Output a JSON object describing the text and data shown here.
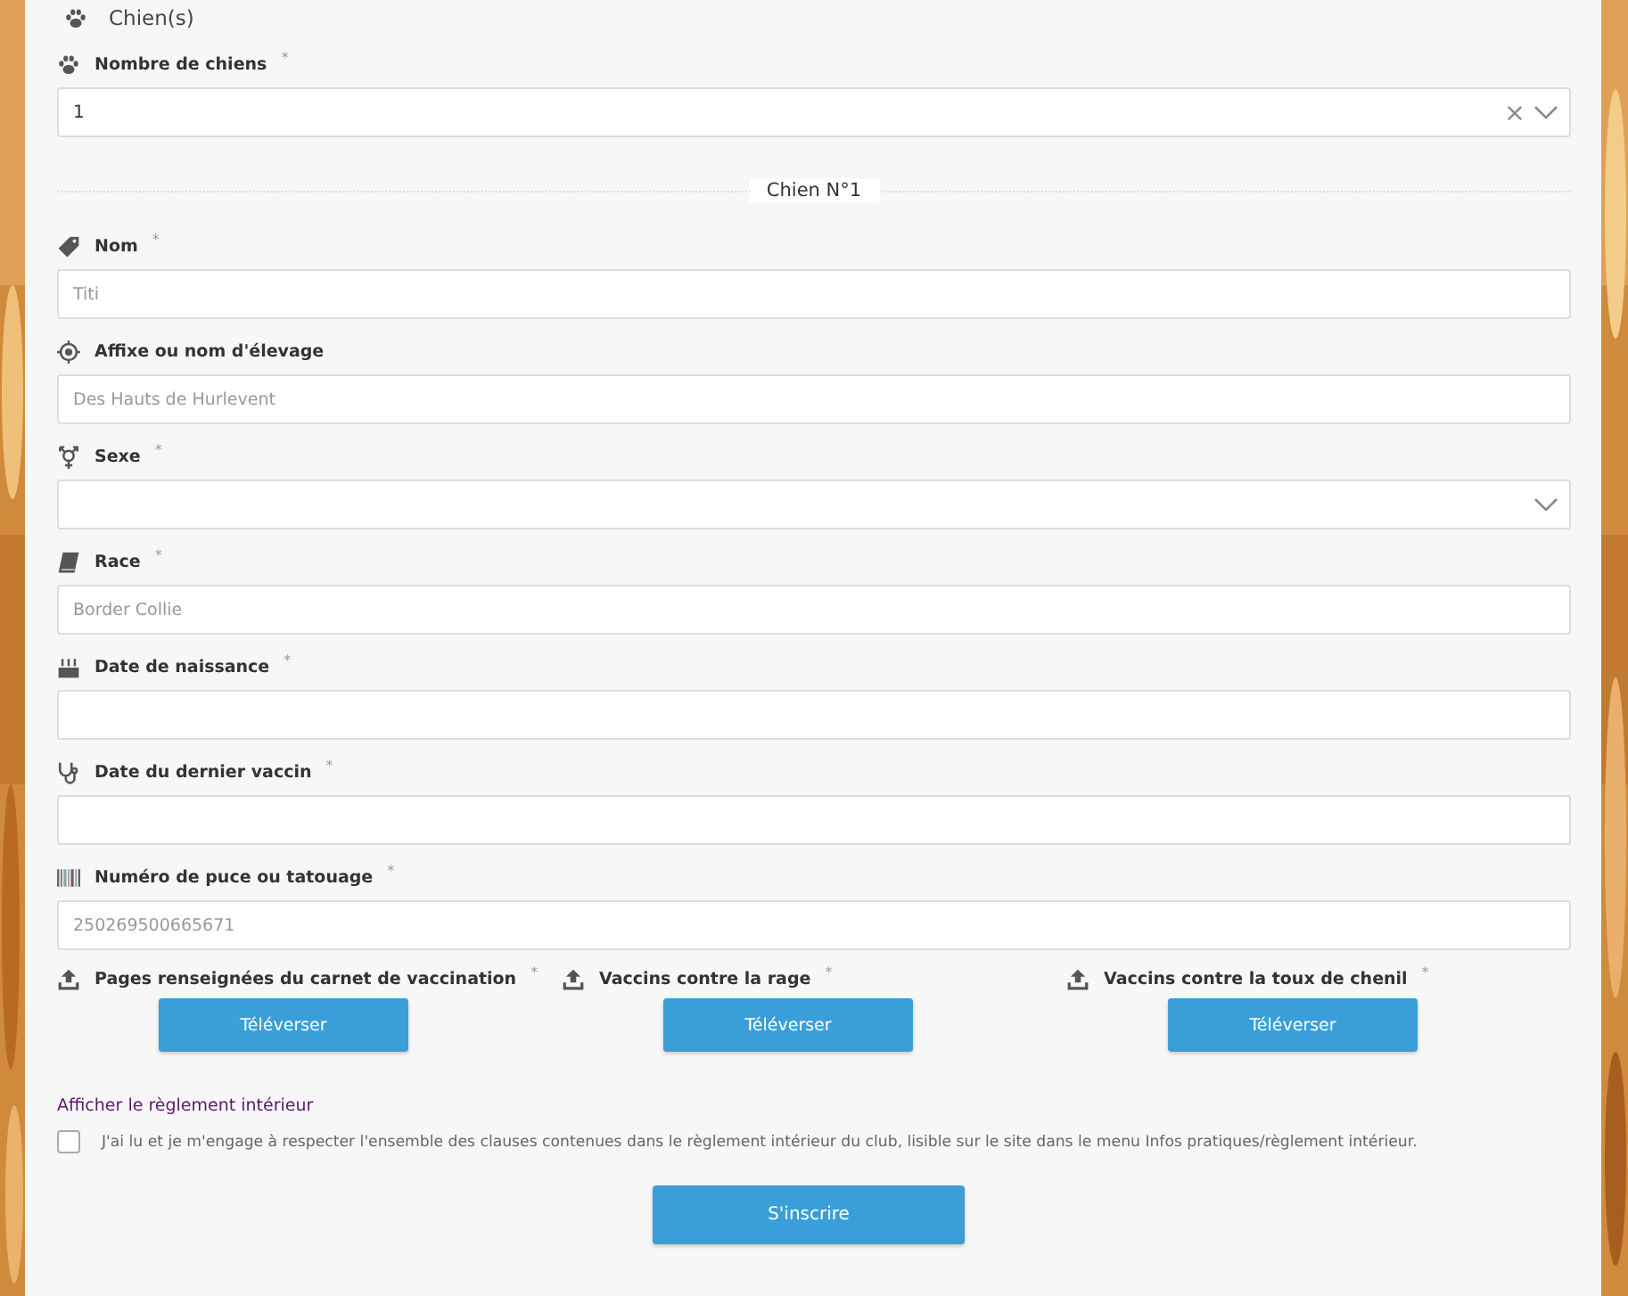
{
  "section": {
    "title": "Chien(s)"
  },
  "count_field": {
    "label": "Nombre de chiens",
    "required_mark": "*",
    "value": "1",
    "clearable": true
  },
  "divider": {
    "label": "Chien N°1"
  },
  "fields": [
    {
      "kind": "text",
      "label": "Nom",
      "required_mark": "*",
      "placeholder": "Titi"
    },
    {
      "kind": "text",
      "label": "Affixe ou nom d'élevage",
      "placeholder": "Des Hauts de Hurlevent"
    },
    {
      "kind": "select",
      "label": "Sexe",
      "required_mark": "*"
    },
    {
      "kind": "text",
      "label": "Race",
      "required_mark": "*",
      "placeholder": "Border Collie"
    },
    {
      "kind": "text",
      "label": "Date de naissance",
      "required_mark": "*"
    },
    {
      "kind": "text",
      "label": "Date du dernier vaccin",
      "required_mark": "*"
    },
    {
      "kind": "text",
      "label": "Numéro de puce ou tatouage",
      "required_mark": "*",
      "placeholder": "250269500665671"
    }
  ],
  "uploads": [
    {
      "label": "Pages renseignées du carnet de vaccination",
      "required_mark": "*",
      "button": "Téléverser"
    },
    {
      "label": "Vaccins contre la rage",
      "required_mark": "*",
      "button": "Téléverser"
    },
    {
      "label": "Vaccins contre la toux de chenil",
      "required_mark": "*",
      "button": "Téléverser"
    }
  ],
  "rules_link": "Afficher le règlement intérieur",
  "agreement": {
    "checked": false,
    "text": "J'ai lu et je m'engage à respecter l'ensemble des clauses contenues dans le règlement intérieur du club, lisible sur le site dans le menu Infos pratiques/règlement intérieur."
  },
  "submit": "S'inscrire"
}
